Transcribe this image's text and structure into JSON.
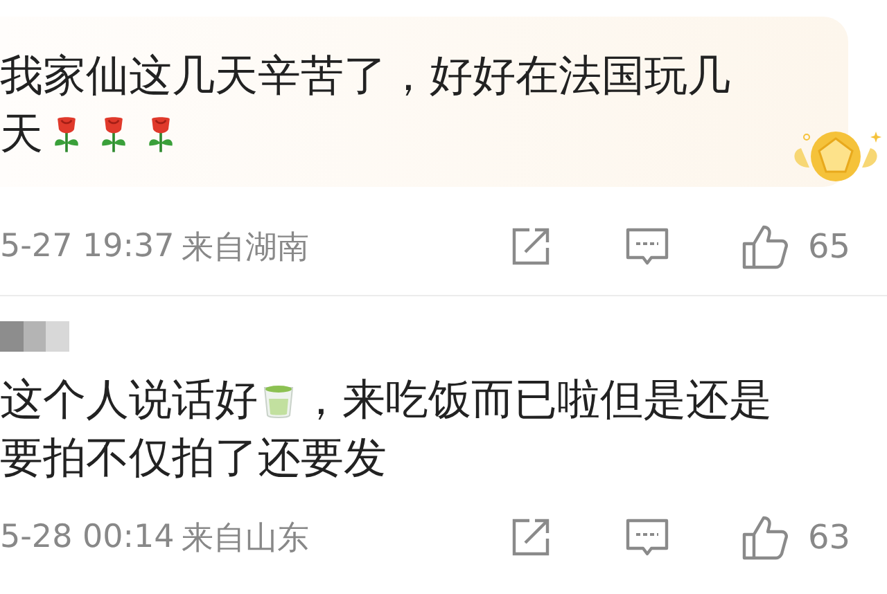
{
  "comments": [
    {
      "highlighted": true,
      "lines": [
        [
          {
            "kind": "text",
            "text": "我家仙这几天辛苦了，好好在法国玩几"
          }
        ],
        [
          {
            "kind": "text",
            "text": "天"
          },
          {
            "kind": "rose"
          },
          {
            "kind": "rose"
          },
          {
            "kind": "rose"
          }
        ]
      ],
      "time": "5-27 19:37",
      "location": "来自湖南",
      "likes": "65"
    },
    {
      "author": {
        "kind": "blurred"
      },
      "highlighted": false,
      "lines": [
        [
          {
            "kind": "text",
            "text": "这个人说话好"
          },
          {
            "kind": "tea"
          },
          {
            "kind": "text",
            "text": "，来吃饭而已啦但是还是"
          }
        ],
        [
          {
            "kind": "text",
            "text": "要拍不仅拍了还要发"
          }
        ]
      ],
      "time": "5-28 00:14",
      "location": "来自山东",
      "likes": "63"
    }
  ]
}
